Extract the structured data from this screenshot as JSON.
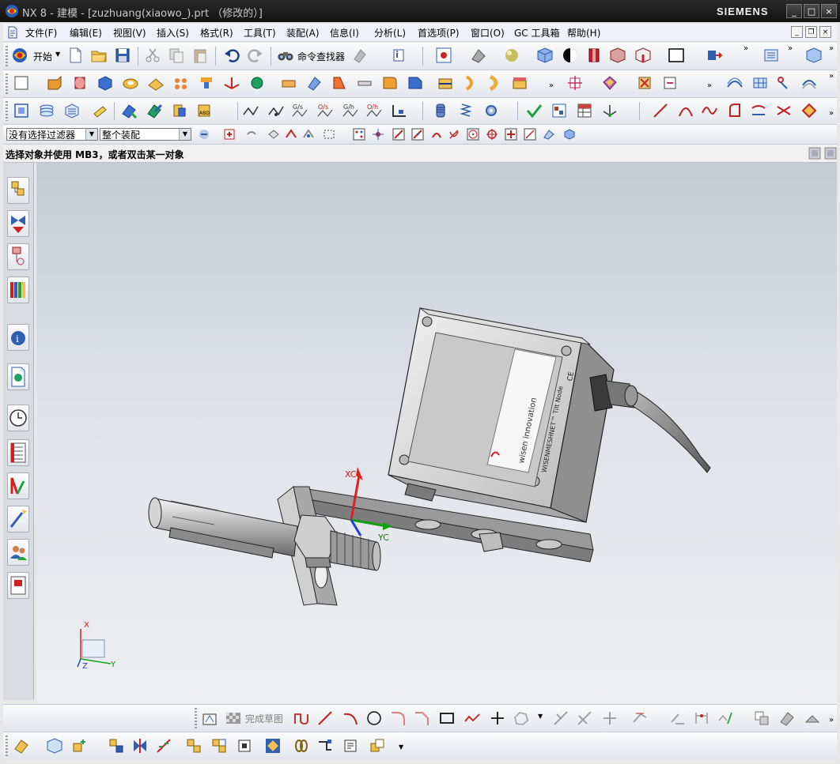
{
  "window": {
    "title": "NX 8 - 建模 - [zuzhuang(xiaowo_).prt （修改的）]",
    "brand": "SIEMENS",
    "controls": [
      "_",
      "□",
      "×"
    ]
  },
  "menubar": {
    "items": [
      "文件(F)",
      "编辑(E)",
      "视图(V)",
      "插入(S)",
      "格式(R)",
      "工具(T)",
      "装配(A)",
      "信息(I)",
      "分析(L)",
      "首选项(P)",
      "窗口(O)",
      "GC 工具箱",
      "帮助(H)"
    ],
    "mdi_controls": [
      "_",
      "❐",
      "×"
    ]
  },
  "toolbar_standard": {
    "start_label": "开始",
    "command_finder_label": "命令查找器"
  },
  "selection_bar": {
    "type_filter": "没有选择过滤器",
    "scope_filter": "整个装配"
  },
  "cue_line": {
    "text": "选择对象并使用 MB3，或者双击某一对象"
  },
  "viewport": {
    "wcs_labels": {
      "xc": "XC",
      "yc": "YC"
    },
    "triad_labels": {
      "x": "X",
      "y": "Y",
      "z": "Z"
    },
    "label_plate": {
      "brand": "wisen innovation",
      "product": "WISENMESHNET™ Tilt Node",
      "mark": "CE"
    }
  },
  "sketch_toolbar": {
    "finish_sketch_label": "完成草图"
  },
  "colors": {
    "titlebar": "#1a1a1a",
    "menubar": "#eef2f8",
    "viewport_top": "#c6cbd4",
    "viewport_bottom": "#eeeff2",
    "wcs_x": "#e02020",
    "wcs_y": "#10a010",
    "wcs_z": "#2040d0"
  }
}
